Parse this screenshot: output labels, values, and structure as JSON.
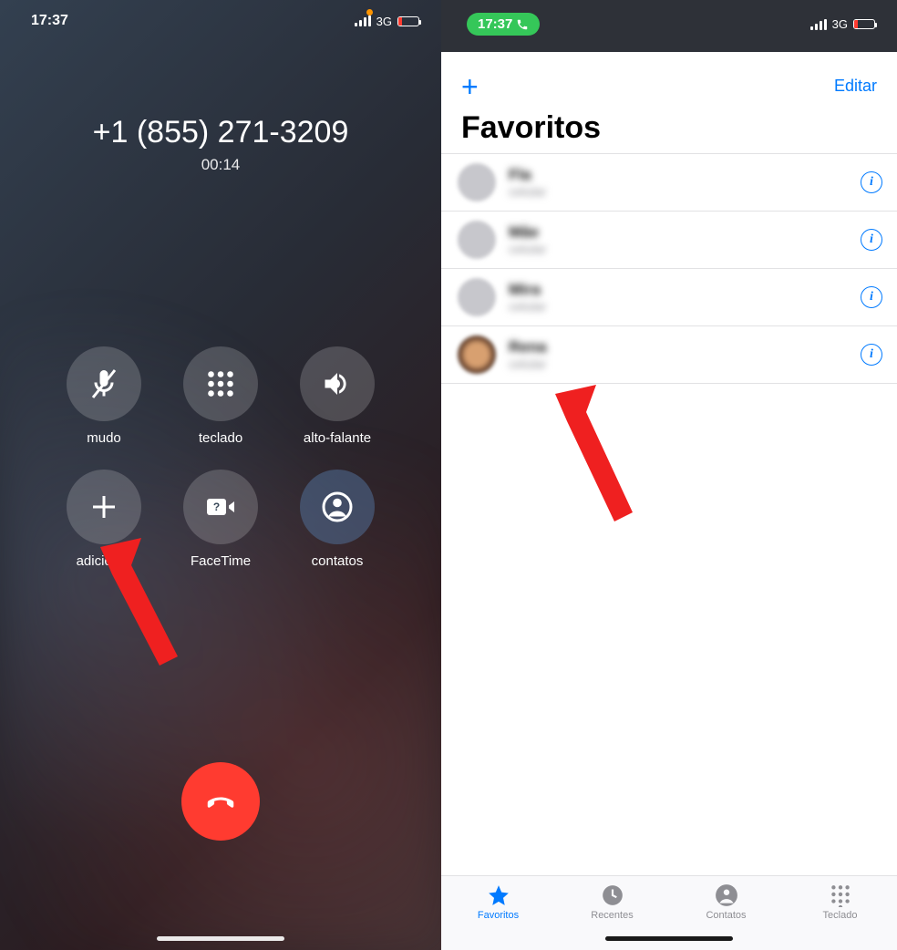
{
  "left": {
    "status": {
      "time": "17:37",
      "network": "3G"
    },
    "call": {
      "number": "+1 (855) 271-3209",
      "duration": "00:14"
    },
    "buttons": {
      "mute": "mudo",
      "keypad": "teclado",
      "speaker": "alto-falante",
      "add": "adicionar",
      "facetime": "FaceTime",
      "contacts": "contatos"
    }
  },
  "right": {
    "status": {
      "time": "17:37",
      "network": "3G"
    },
    "nav": {
      "edit": "Editar"
    },
    "title": "Favoritos",
    "rows": [
      {
        "name": "Fla",
        "sub": "celular"
      },
      {
        "name": "Mãe",
        "sub": "celular"
      },
      {
        "name": "Mira",
        "sub": "celular"
      },
      {
        "name": "Rena",
        "sub": "celular"
      }
    ],
    "tabs": {
      "favorites": "Favoritos",
      "recents": "Recentes",
      "contacts": "Contatos",
      "keypad": "Teclado"
    }
  }
}
